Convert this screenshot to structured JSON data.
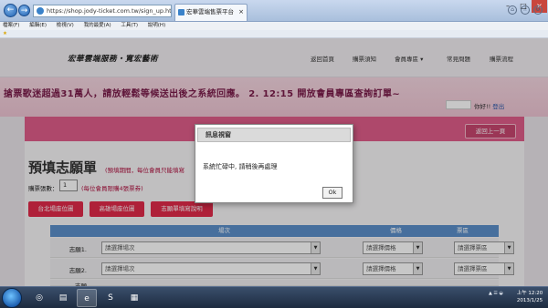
{
  "browser": {
    "url": "https://shop.jody-ticket.com.tw/sign_up.html",
    "address_tools": "☰ → ×",
    "tab_title": "宏華雲端售票平台",
    "tab_close": "×",
    "back_glyph": "←",
    "forward_glyph": "→",
    "win_min": "–",
    "win_max": "□",
    "win_close": "×",
    "menu": [
      "檔案(F)",
      "編輯(E)",
      "檢視(V)",
      "我的最愛(A)",
      "工具(T)",
      "說明(H)"
    ],
    "fav_star": "★"
  },
  "site": {
    "logo": "宏華雲端服務・寬宏藝術",
    "nav": [
      "返回首頁",
      "購票須知",
      "會員專區 ▾",
      "常見問題",
      "購票流程"
    ],
    "marquee": "搶票歌迷超過31萬人，請放輕鬆等候送出後之系統回應。 2. 12:15 開放會員專區查詢訂單~",
    "greeting": "你好!! ",
    "logout": "登出"
  },
  "form": {
    "back_button": "返回上一頁",
    "title": "預填志願單",
    "note": "(預填期間，每位會員只能填寫",
    "qty_label": "購票張數：",
    "qty_value": "1",
    "qty_note": "(每位會員限購4張票券)",
    "buttons": [
      "台北場座位圖",
      "高雄場座位圖",
      "志願單填寫說明"
    ],
    "columns": [
      "場次",
      "價格",
      "票區"
    ],
    "rows": [
      {
        "label": "志願1.",
        "show": "請選擇場次",
        "price": "請選擇價格",
        "zone": "請選擇票區"
      },
      {
        "label": "志願2.",
        "show": "請選擇場次",
        "price": "請選擇價格",
        "zone": "請選擇票區"
      },
      {
        "label": "志願",
        "show": "",
        "price": "",
        "zone": ""
      }
    ]
  },
  "modal": {
    "title": "訊息視窗",
    "message": "系統忙碌中, 請稍後再處理",
    "ok": "Ok"
  },
  "taskbar": {
    "apps": [
      "◎",
      "▤",
      "e",
      "S",
      "▦"
    ],
    "tray": "▲ ☰ ◒",
    "time": "上午 12:20",
    "date": "2013/1/25"
  },
  "colors": {
    "accent_pink": "#df5d8a",
    "button_red": "#e0294a",
    "table_head": "#5b8fc9",
    "marquee_text": "#7a1c4a"
  }
}
